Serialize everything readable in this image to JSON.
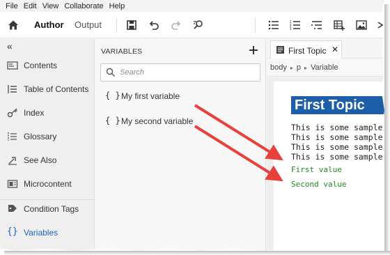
{
  "menu": [
    "File",
    "Edit",
    "View",
    "Collaborate",
    "Help"
  ],
  "toolbar": {
    "tab_author": "Author",
    "tab_output": "Output"
  },
  "nav": {
    "collapse": "«",
    "items": [
      {
        "label": "Contents",
        "icon": "contents-icon"
      },
      {
        "label": "Table of Contents",
        "icon": "toc-icon"
      },
      {
        "label": "Index",
        "icon": "key-icon"
      },
      {
        "label": "Glossary",
        "icon": "glossary-icon"
      },
      {
        "label": "See Also",
        "icon": "see-also-icon"
      },
      {
        "label": "Microcontent",
        "icon": "microcontent-icon"
      },
      {
        "label": "Condition Tags",
        "icon": "condition-tag-icon"
      },
      {
        "label": "Variables",
        "icon": "braces-icon",
        "active": true
      }
    ]
  },
  "variables": {
    "title": "VARIABLES",
    "add": "+",
    "search_placeholder": "Search",
    "items": [
      {
        "brace": "{ }",
        "label": "My first variable"
      },
      {
        "brace": "{ }",
        "label": "My second variable"
      }
    ]
  },
  "editor": {
    "tab_label": "First Topic",
    "tab_close": "✕",
    "breadcrumb": [
      "body",
      "p",
      "Variable"
    ],
    "heading": "First Topic",
    "paragraphs": [
      "This is some sample te",
      "This is some sample te",
      "This is some sample te",
      "This is some sample te"
    ],
    "var_values": [
      "First value",
      "Second value"
    ]
  },
  "colors": {
    "accent": "#1b64c4",
    "heading_bg": "#1d5ea8",
    "var_value": "#1f8a1f",
    "arrow": "#e8403c"
  }
}
